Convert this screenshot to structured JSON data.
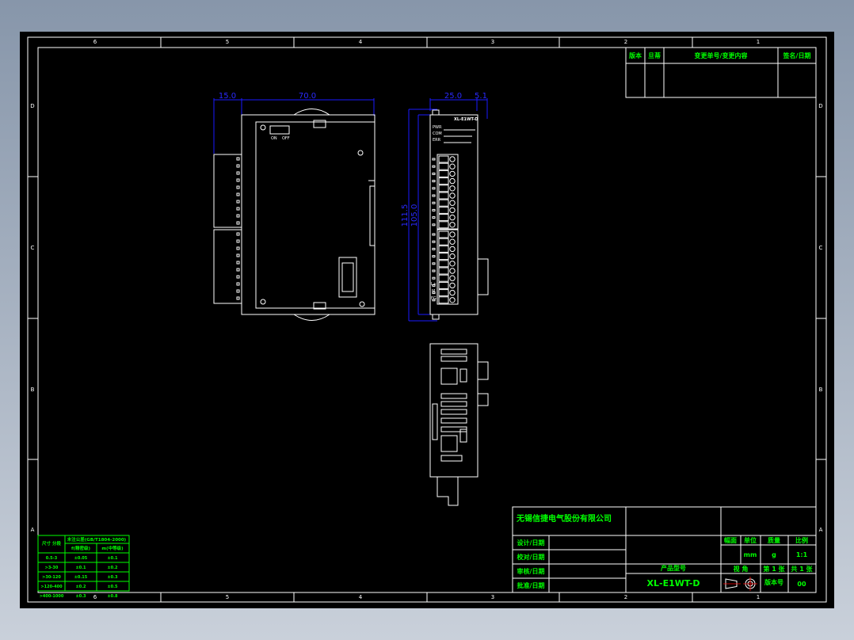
{
  "frame": {
    "zones_top": [
      "6",
      "5",
      "4",
      "3",
      "2",
      "1"
    ],
    "zones_side": [
      "D",
      "C",
      "B",
      "A"
    ]
  },
  "revision_table": {
    "headers": [
      "版本",
      "旦蒂",
      "变更单号/变更内容",
      "签名/日期"
    ]
  },
  "title_block": {
    "company": "无锡信捷电气股份有限公司",
    "rows": [
      "设计/日期",
      "校对/日期",
      "审核/日期",
      "批准/日期"
    ],
    "product_model_label": "产品型号",
    "product_model": "XL-E1WT-D",
    "headers": [
      "幅面",
      "单位",
      "质量",
      "比例"
    ],
    "unit": "mm",
    "mass_unit": "g",
    "scale": "1:1",
    "projection_label": "视 角",
    "sheet": "第 1 张",
    "total": "共 1 张",
    "version_label": "版本号",
    "version": "00"
  },
  "tolerance_table": {
    "col1": "尺寸 分段",
    "title": "未注公差(GB/T1804-2000)",
    "col2": "f(精密级)",
    "col3": "m(中等级)",
    "rows": [
      [
        "0.5-3",
        "±0.05",
        "±0.1"
      ],
      [
        ">3-30",
        "±0.1",
        "±0.2"
      ],
      [
        ">30-120",
        "±0.15",
        "±0.3"
      ],
      [
        ">120-400",
        "±0.2",
        "±0.5"
      ],
      [
        ">400-1000",
        "±0.3",
        "±0.8"
      ]
    ]
  },
  "dimensions": {
    "front_left": "15.0",
    "front_width": "70.0",
    "side_width": "25.0",
    "side_offset": "5.1",
    "side_height_outer": "111.5",
    "side_height_inner": "105.0"
  },
  "labels": {
    "switch_on": "ON",
    "switch_off": "OFF",
    "model_print": "XL-E1WT-D",
    "led_pwr": "PWR",
    "led_com": "COM",
    "led_err": "ERR",
    "term_lplus": "L+",
    "term_m": "M",
    "term_fg": "FG"
  },
  "colors": {
    "text": "#00ff00",
    "dimension": "#1a1aff",
    "lines": "#ffffff",
    "background": "#000000"
  }
}
